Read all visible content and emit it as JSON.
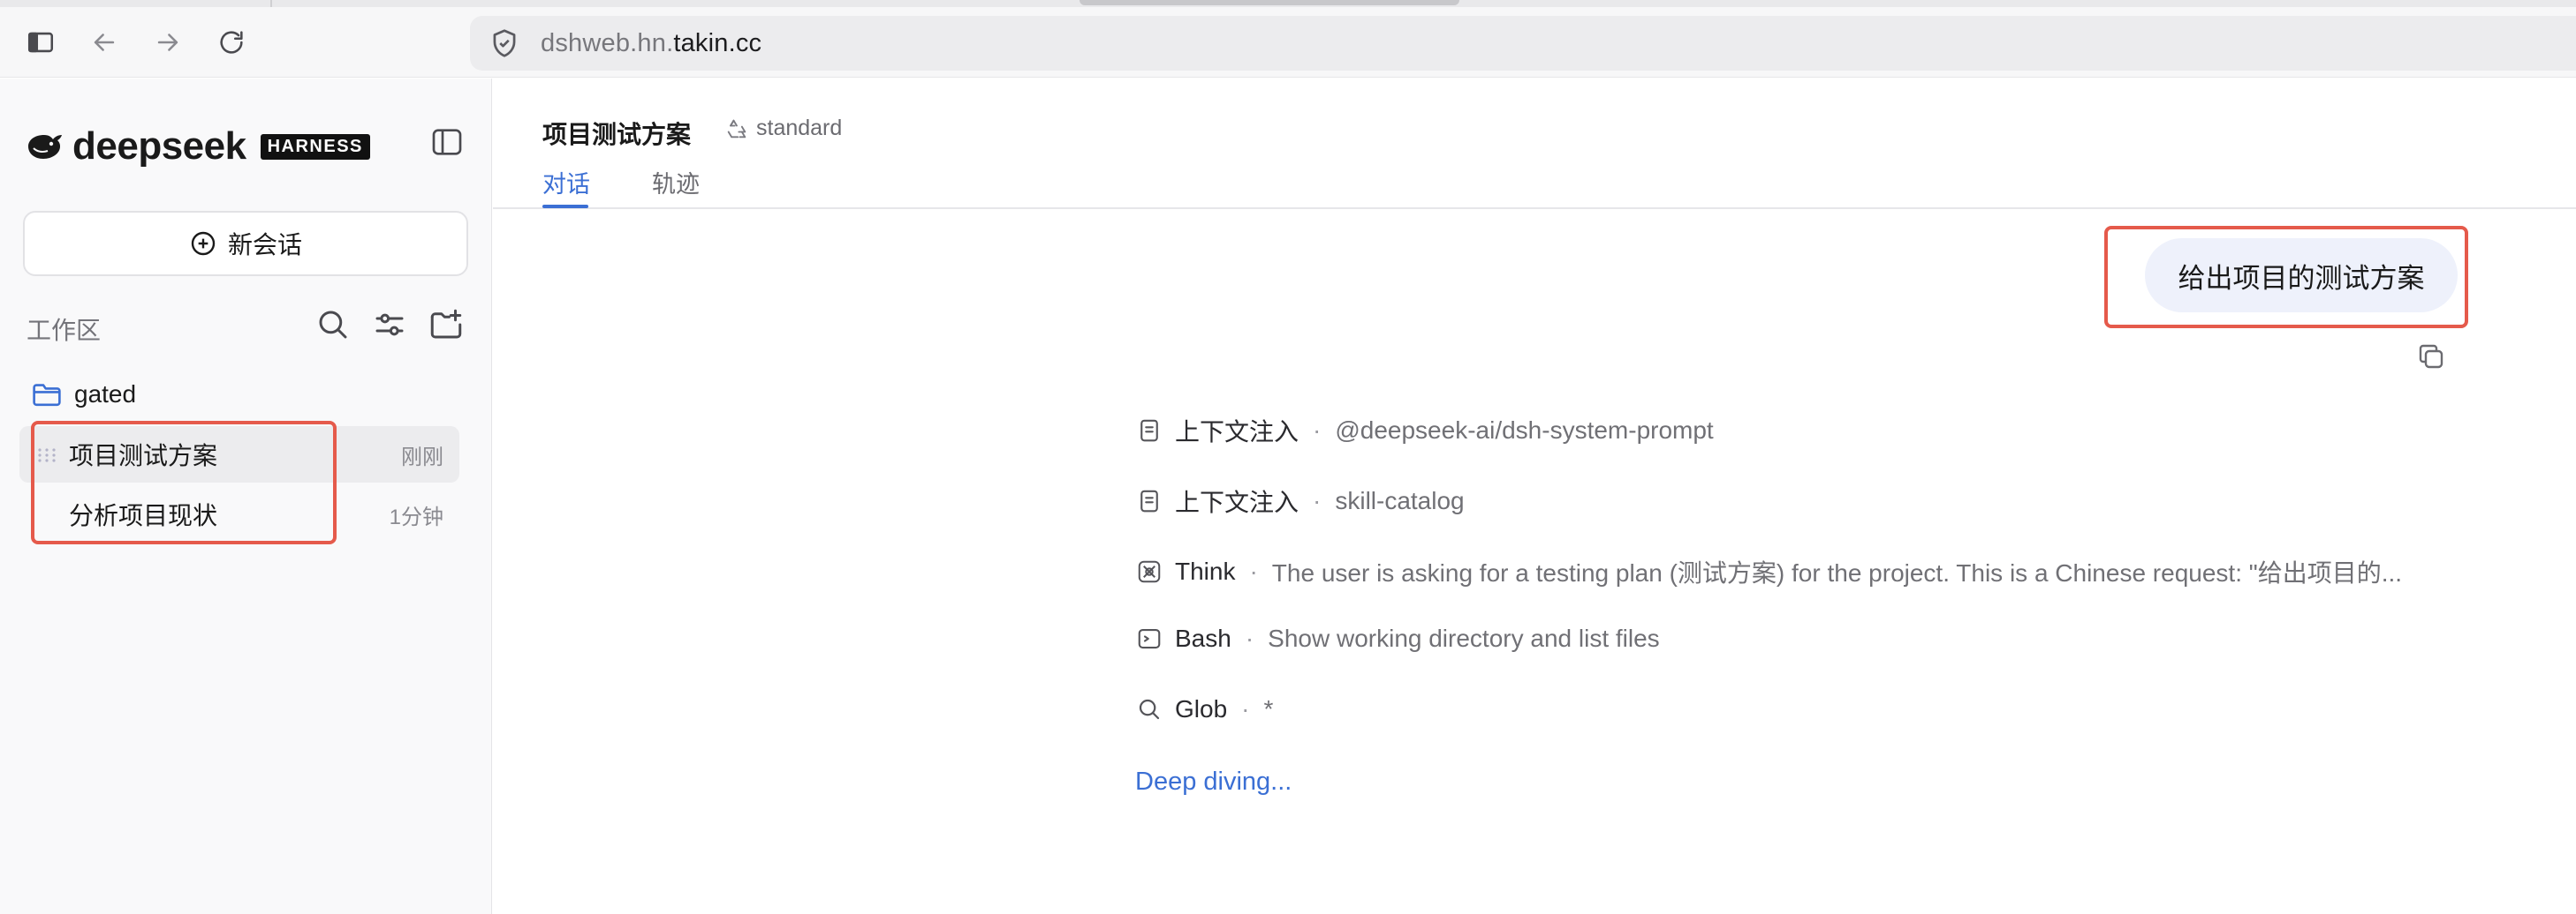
{
  "browser": {
    "url_prefix": "dshweb.hn.",
    "url_host": "takin.cc"
  },
  "sidebar": {
    "brand_name": "deepseek",
    "brand_badge": "HARNESS",
    "new_chat_label": "新会话",
    "workspace_label": "工作区",
    "folder_name": "gated",
    "sessions": [
      {
        "title": "项目测试方案",
        "time": "刚刚",
        "active": true
      },
      {
        "title": "分析项目现状",
        "time": "1分钟",
        "active": false
      }
    ]
  },
  "main": {
    "title": "项目测试方案",
    "mode_label": "standard",
    "tabs": [
      {
        "label": "对话",
        "active": true
      },
      {
        "label": "轨迹",
        "active": false
      }
    ],
    "user_message": "给出项目的测试方案",
    "steps": [
      {
        "icon": "document-icon",
        "kind": "上下文注入",
        "detail": "@deepseek-ai/dsh-system-prompt"
      },
      {
        "icon": "document-icon",
        "kind": "上下文注入",
        "detail": "skill-catalog"
      },
      {
        "icon": "brain-icon",
        "kind": "Think",
        "detail": "The user is asking for a testing plan (测试方案) for the project. This is a Chinese request: \"给出项目的..."
      },
      {
        "icon": "terminal-icon",
        "kind": "Bash",
        "detail": "Show working directory and list files"
      },
      {
        "icon": "search-icon",
        "kind": "Glob",
        "detail": "*"
      }
    ],
    "status_text": "Deep diving..."
  },
  "colors": {
    "accent": "#3b6fd4",
    "highlight_border": "#e55a4b",
    "user_bubble": "#eef1fb"
  }
}
